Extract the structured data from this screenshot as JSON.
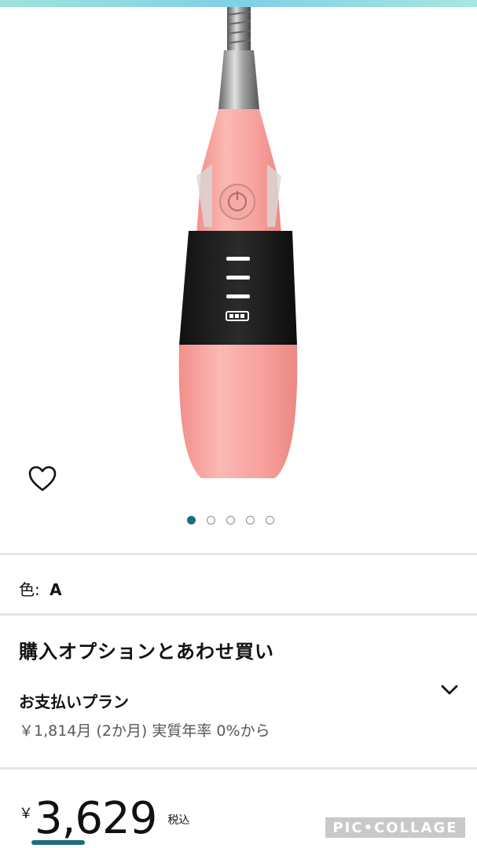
{
  "product": {
    "image_alt": "pink heated eyelash curler",
    "color_label": "色:",
    "color_value": "A"
  },
  "gallery": {
    "wishlist_icon": "heart-outline-icon",
    "image_count": 5,
    "active_index": 0
  },
  "options": {
    "section_title": "購入オプションとあわせ買い",
    "payment_plan_title": "お支払いプラン",
    "payment_plan_detail": "￥1,814月 (2か月) 実質年率 0%から",
    "expand_icon": "chevron-down-icon"
  },
  "price": {
    "currency": "￥",
    "amount": "3,629",
    "tax_note": "税込"
  },
  "watermark": "PIC•COLLAGE",
  "colors": {
    "accent": "#1a6e80",
    "divider": "#e3e6e6",
    "product_pink": "#f6a6a2"
  }
}
